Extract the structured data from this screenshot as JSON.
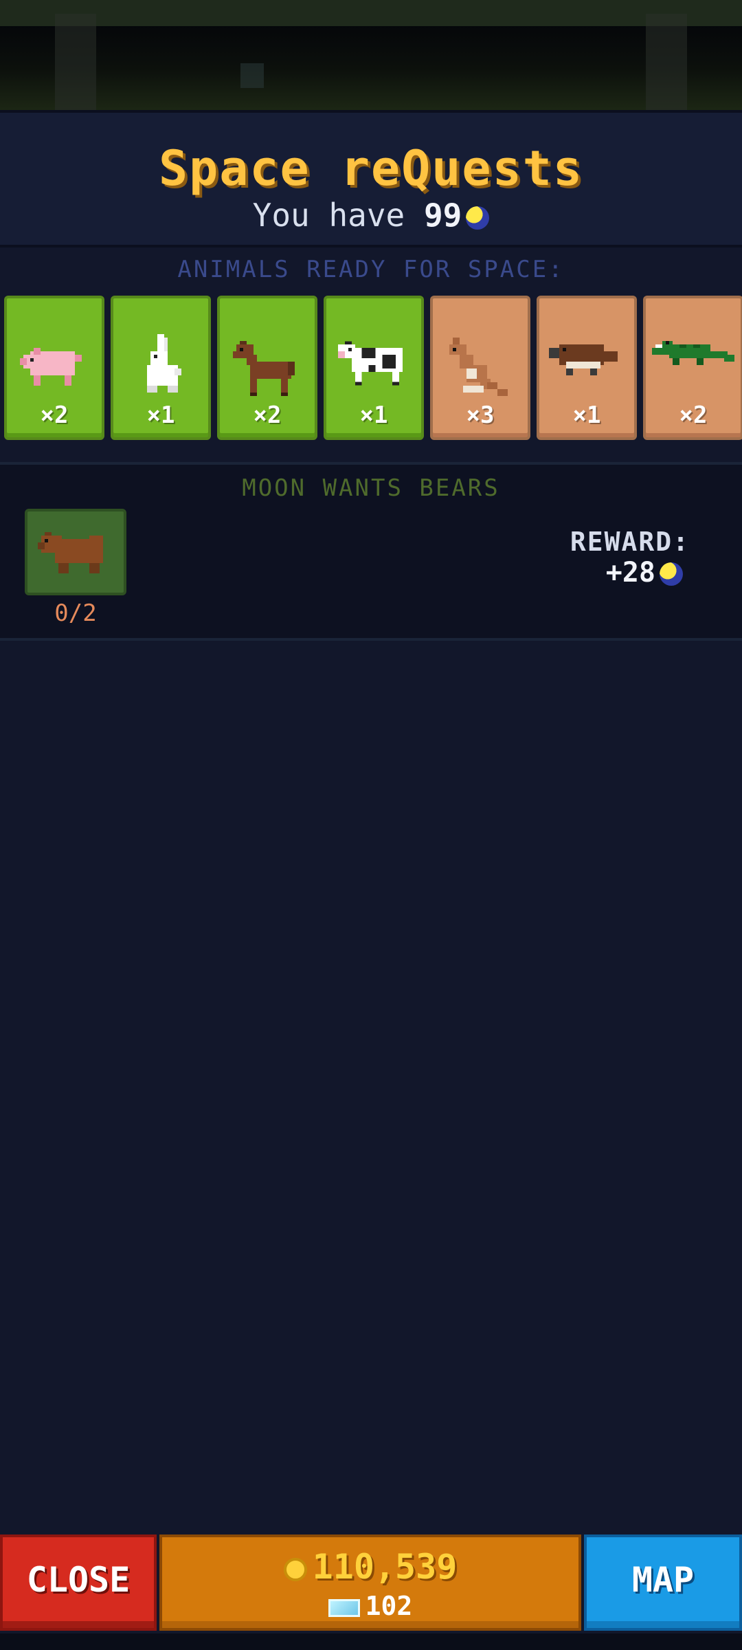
{
  "header": {
    "title": "Space reQuests",
    "you_have_prefix": "You have",
    "you_have_value": "99",
    "currency_icon": "moon-coin-icon"
  },
  "ready": {
    "label": "ANIMALS READY FOR SPACE:",
    "animals": [
      {
        "name": "pig",
        "count": "×2",
        "biome": "green"
      },
      {
        "name": "rabbit",
        "count": "×1",
        "biome": "green"
      },
      {
        "name": "horse",
        "count": "×2",
        "biome": "green"
      },
      {
        "name": "cow",
        "count": "×1",
        "biome": "green"
      },
      {
        "name": "kangaroo",
        "count": "×3",
        "biome": "sand"
      },
      {
        "name": "platypus",
        "count": "×1",
        "biome": "sand"
      },
      {
        "name": "crocodile",
        "count": "×2",
        "biome": "sand"
      }
    ]
  },
  "request": {
    "title": "MOON WANTS BEARS",
    "animal": "bear",
    "progress": "0/2",
    "reward_label": "REWARD:",
    "reward_value": "+28"
  },
  "bottom": {
    "close_label": "CLOSE",
    "coins": "110,539",
    "gems": "102",
    "map_label": "MAP"
  },
  "colors": {
    "title": "#ffc342",
    "green_card": "#74b924",
    "sand_card": "#d79466",
    "close_button": "#d62b1f",
    "map_button": "#1a9be6",
    "currency_bar": "#d47a0c"
  }
}
